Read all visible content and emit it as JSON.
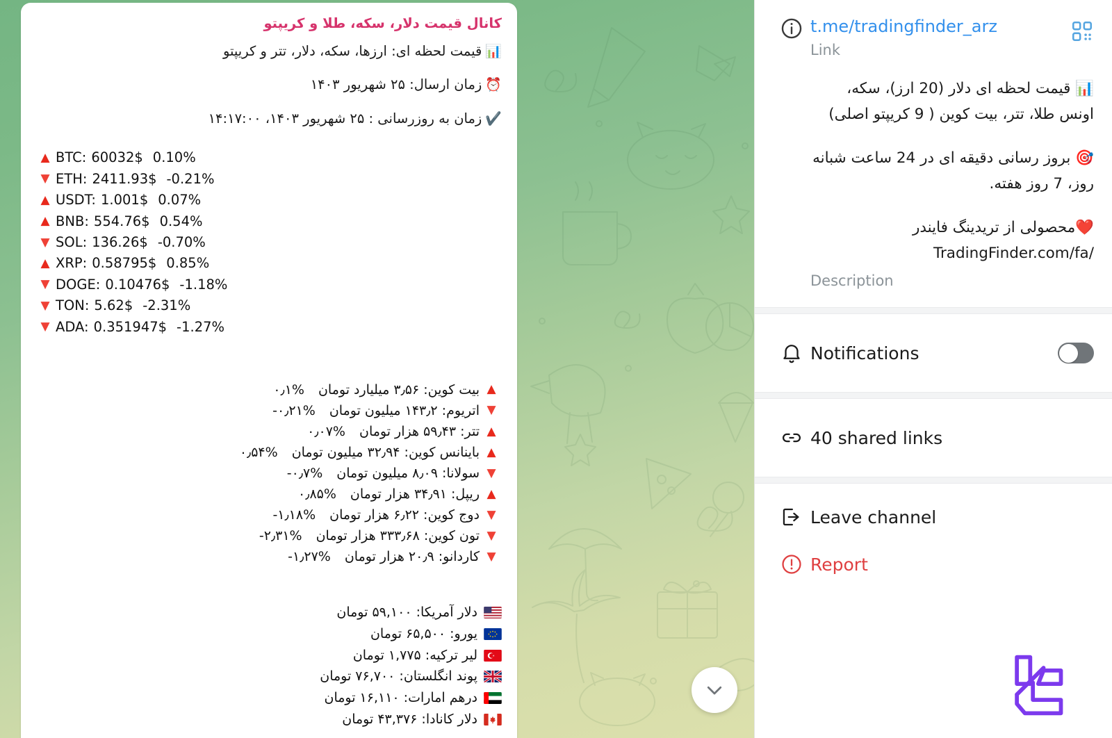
{
  "chat": {
    "message": {
      "title": "کانال قیمت دلار، سکه، طلا و کریپتو",
      "header_lines": [
        {
          "icon": "bar-chart-emoji",
          "text": "قیمت لحظه ای: ارزها، سکه، دلار، تتر و کریپتو"
        },
        {
          "icon": "alarm-clock-emoji",
          "text": "زمان ارسال: ۲۵ شهریور ۱۴۰۳"
        },
        {
          "icon": "check-mark-emoji",
          "text": "زمان به روزرسانی : ۲۵ شهریور ۱۴۰۳، ۱۴:۱۷:۰۰"
        }
      ],
      "crypto_usd": [
        {
          "dir": "up",
          "symbol": "BTC:",
          "price": "60032$",
          "pct": "0.10%"
        },
        {
          "dir": "down",
          "symbol": "ETH:",
          "price": "2411.93$",
          "pct": "-0.21%"
        },
        {
          "dir": "up",
          "symbol": "USDT:",
          "price": "1.001$",
          "pct": "0.07%"
        },
        {
          "dir": "up",
          "symbol": "BNB:",
          "price": "554.76$",
          "pct": "0.54%"
        },
        {
          "dir": "down",
          "symbol": "SOL:",
          "price": "136.26$",
          "pct": "-0.70%"
        },
        {
          "dir": "up",
          "symbol": "XRP:",
          "price": "0.58795$",
          "pct": "0.85%"
        },
        {
          "dir": "down",
          "symbol": "DOGE:",
          "price": "0.10476$",
          "pct": "-1.18%"
        },
        {
          "dir": "down",
          "symbol": "TON:",
          "price": "5.62$",
          "pct": "-2.31%"
        },
        {
          "dir": "down",
          "symbol": "ADA:",
          "price": "0.351947$",
          "pct": "-1.27%"
        }
      ],
      "crypto_toman": [
        {
          "dir": "up",
          "name": "بیت کوین: ۳٫۵۶ میلیارد تومان",
          "pct": "۰٫۱%"
        },
        {
          "dir": "down",
          "name": "اتریوم: ۱۴۳٫۲ میلیون تومان",
          "pct": "-۰٫۲۱%"
        },
        {
          "dir": "up",
          "name": "تتر: ۵۹٫۴۳ هزار تومان",
          "pct": "۰٫۰۷%"
        },
        {
          "dir": "up",
          "name": "باینانس کوین: ۳۲٫۹۴ میلیون تومان",
          "pct": "۰٫۵۴%"
        },
        {
          "dir": "down",
          "name": "سولانا: ۸٫۰۹ میلیون تومان",
          "pct": "-۰٫۷%"
        },
        {
          "dir": "up",
          "name": "ریپل: ۳۴٫۹۱ هزار تومان",
          "pct": "۰٫۸۵%"
        },
        {
          "dir": "down",
          "name": "دوج کوین: ۶٫۲۲ هزار تومان",
          "pct": "-۱٫۱۸%"
        },
        {
          "dir": "down",
          "name": "تون کوین: ۳۳۳٫۶۸ هزار تومان",
          "pct": "-۲٫۳۱%"
        },
        {
          "dir": "down",
          "name": "کاردانو: ۲۰٫۹ هزار تومان",
          "pct": "-۱٫۲۷%"
        }
      ],
      "fiat": [
        {
          "flag": "flag-us",
          "text": "دلار آمریکا: ۵۹,۱۰۰ تومان"
        },
        {
          "flag": "flag-eu",
          "text": "یورو: ۶۵,۵۰۰ تومان"
        },
        {
          "flag": "flag-tr",
          "text": "لیر ترکیه: ۱,۷۷۵ تومان"
        },
        {
          "flag": "flag-gb",
          "text": "پوند انگلستان: ۷۶,۷۰۰ تومان"
        },
        {
          "flag": "flag-ae",
          "text": "درهم امارات: ۱۶,۱۱۰ تومان"
        },
        {
          "flag": "flag-ca",
          "text": "دلار کانادا: ۴۳,۳۷۶ تومان"
        }
      ]
    },
    "scroll_down_icon": "chevron-down-icon"
  },
  "panel": {
    "link": {
      "value": "t.me/tradingfinder_arz",
      "label": "Link",
      "qr_icon": "qr-code-icon",
      "info_icon": "info-icon"
    },
    "about": {
      "line1": "قیمت لحظه ای دلار (20 ارز)، سکه، اونس طلا، تتر، بیت کوین ( 9 کریپتو اصلی)",
      "line1_icon": "bar-chart-emoji",
      "line2": "بروز رسانی دقیقه ای در 24 ساعت شبانه روز، 7 روز هفته.",
      "line2_icon": "dart-emoji",
      "line3": "محصولی از تریدینگ فایندر",
      "line3_icon": "red-heart-emoji",
      "link": "/TradingFinder.com/fa",
      "label": "Description"
    },
    "notifications": {
      "label": "Notifications",
      "icon": "bell-icon",
      "toggle_on": false
    },
    "shared_links": {
      "label": "40 shared links",
      "icon": "link-icon"
    },
    "leave": {
      "label": "Leave channel",
      "icon": "logout-icon"
    },
    "report": {
      "label": "Report",
      "icon": "alert-circle-icon"
    }
  },
  "watermark": {
    "name": "tradingfinder-logo",
    "color": "#7c3aed"
  },
  "colors": {
    "accent_link": "#3390ec",
    "title_pink": "#d6336c",
    "danger": "#df3f40",
    "up_red": "#e8291c",
    "down_red": "#ef4136"
  }
}
